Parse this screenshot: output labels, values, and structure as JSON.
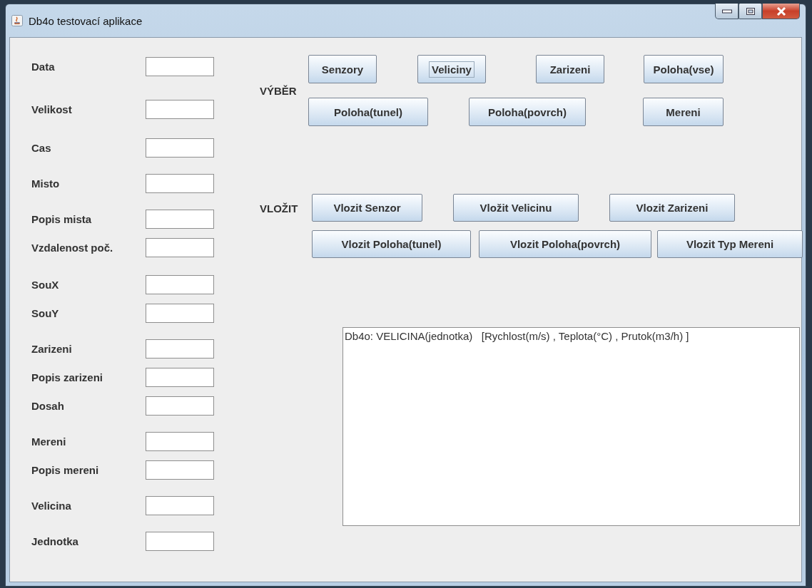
{
  "window": {
    "title": "Db4o testovací aplikace"
  },
  "fields": [
    {
      "label": "Data"
    },
    {
      "label": "Velikost"
    },
    {
      "label": "Cas"
    },
    {
      "label": "Misto"
    },
    {
      "label": "Popis mista"
    },
    {
      "label": "Vzdalenost poč."
    },
    {
      "label": "SouX"
    },
    {
      "label": "SouY"
    },
    {
      "label": "Zarizeni"
    },
    {
      "label": "Popis zarizeni"
    },
    {
      "label": "Dosah"
    },
    {
      "label": "Mereni"
    },
    {
      "label": "Popis mereni"
    },
    {
      "label": "Velicina"
    },
    {
      "label": "Jednotka"
    }
  ],
  "vyber": {
    "label": "VÝBĚR",
    "buttons": [
      {
        "label": "Senzory",
        "focused": false
      },
      {
        "label": "Veliciny",
        "focused": true
      },
      {
        "label": "Zarizeni",
        "focused": false
      },
      {
        "label": "Poloha(vse)",
        "focused": false
      },
      {
        "label": "Poloha(tunel)",
        "focused": false
      },
      {
        "label": "Poloha(povrch)",
        "focused": false
      },
      {
        "label": "Mereni",
        "focused": false
      }
    ]
  },
  "vlozit": {
    "label": "VLOŽIT",
    "buttons": [
      {
        "label": "Vlozit Senzor",
        "focused": false
      },
      {
        "label": "Vložit Velicinu",
        "focused": false
      },
      {
        "label": "Vlozit Zarizeni",
        "focused": false
      },
      {
        "label": "Vlozit Poloha(tunel)",
        "focused": false
      },
      {
        "label": "Vlozit Poloha(povrch)",
        "focused": false
      },
      {
        "label": "Vlozit Typ Mereni",
        "focused": false
      }
    ]
  },
  "output": {
    "value": "Db4o: VELICINA(jednotka)   [Rychlost(m/s) , Teplota(°C) , Prutok(m3/h) ]"
  }
}
